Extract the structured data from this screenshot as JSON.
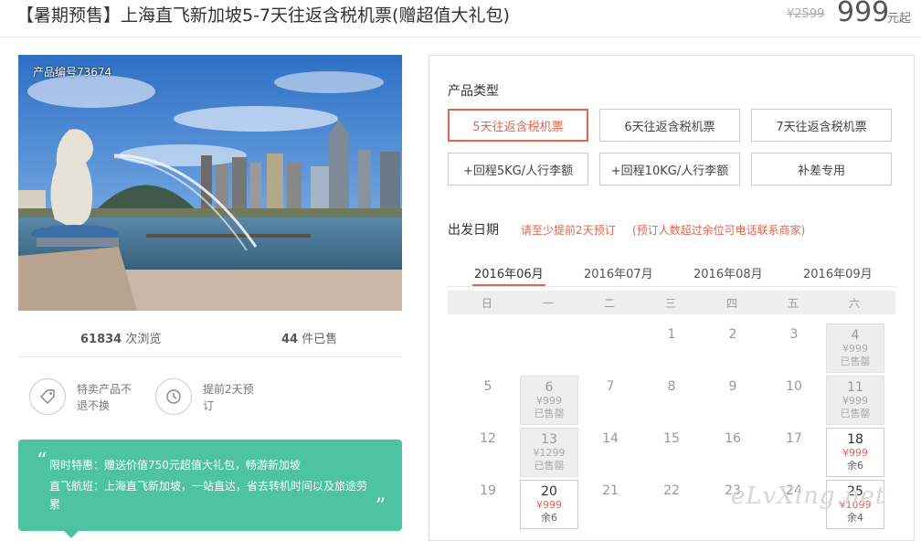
{
  "header": {
    "title": "【暑期预售】上海直飞新加坡5-7天往返含税机票(赠超值大礼包)",
    "old_price": "¥2599",
    "price": "999",
    "price_unit": "元起"
  },
  "hero": {
    "product_no": "产品编号73674"
  },
  "stats": {
    "views_count": "61834",
    "views_label": " 次浏览",
    "sold_count": "44",
    "sold_label": " 件已售"
  },
  "features": [
    {
      "icon": "tag-icon",
      "text": "特卖产品不退不换"
    },
    {
      "icon": "clock-icon",
      "text": "提前2天预订"
    }
  ],
  "promo": {
    "line1": "限时特惠：赠送价值750元超值大礼包，畅游新加坡",
    "line2": "直飞航班：上海直飞新加坡，一站直达，省去转机时间以及旅途劳累",
    "quote_open": "“",
    "quote_close": "”"
  },
  "product_type": {
    "label": "产品类型",
    "options": [
      "5天往返含税机票",
      "6天往返含税机票",
      "7天往返含税机票",
      "+回程5KG/人行李额",
      "+回程10KG/人行李额",
      "补差专用"
    ],
    "selected": "5天往返含税机票"
  },
  "departure": {
    "label": "出发日期",
    "note1": "请至少提前2天预订",
    "note2": "(预订人数超过余位可电话联系商家)",
    "months": [
      "2016年06月",
      "2016年07月",
      "2016年08月",
      "2016年09月"
    ],
    "active_month": "2016年06月",
    "weekdays": [
      "日",
      "一",
      "二",
      "三",
      "四",
      "五",
      "六"
    ]
  },
  "calendar": {
    "plain_days": [
      "1",
      "2",
      "3",
      "5",
      "7",
      "8",
      "9",
      "10",
      "12",
      "14",
      "15",
      "16",
      "17",
      "19",
      "21",
      "22",
      "23",
      "24"
    ],
    "cells": [
      {
        "day": "4",
        "price": "¥999",
        "status": "已售罄"
      },
      {
        "day": "6",
        "price": "¥999",
        "status": "已售罄"
      },
      {
        "day": "11",
        "price": "¥999",
        "status": "已售罄"
      },
      {
        "day": "13",
        "price": "¥1299",
        "status": "已售罄"
      },
      {
        "day": "18",
        "price": "¥999",
        "status": "余6"
      },
      {
        "day": "20",
        "price": "¥999",
        "status": "余6"
      },
      {
        "day": "25",
        "price": "¥1099",
        "status": "余4"
      }
    ]
  },
  "watermark": "eLvXing.net",
  "colors": {
    "accent": "#e0664f",
    "promo_bg": "#4dc39f",
    "sold_bg": "#eeeeee"
  }
}
